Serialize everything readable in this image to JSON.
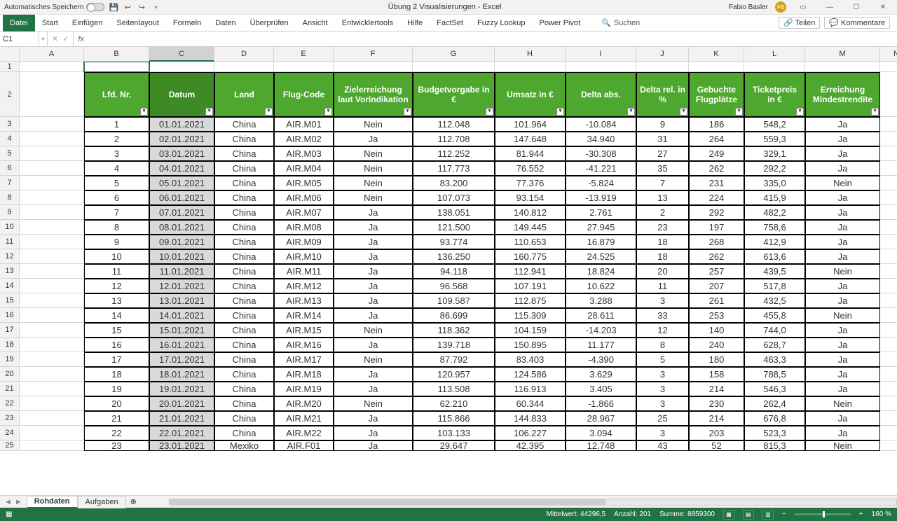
{
  "titlebar": {
    "autosave_label": "Automatisches Speichern",
    "doc_title": "Übung 2 Visualisierungen  -  Excel",
    "user_name": "Fabio Basler",
    "user_initials": "FB"
  },
  "ribbon": {
    "tabs": [
      "Datei",
      "Start",
      "Einfügen",
      "Seitenlayout",
      "Formeln",
      "Daten",
      "Überprüfen",
      "Ansicht",
      "Entwicklertools",
      "Hilfe",
      "FactSet",
      "Fuzzy Lookup",
      "Power Pivot"
    ],
    "search_placeholder": "Suchen",
    "share": "Teilen",
    "comments": "Kommentare"
  },
  "namebox": "C1",
  "columns": [
    "A",
    "B",
    "C",
    "D",
    "E",
    "F",
    "G",
    "H",
    "I",
    "J",
    "K",
    "L",
    "M",
    "N"
  ],
  "headers": [
    "Lfd. Nr.",
    "Datum",
    "Land",
    "Flug-Code",
    "Zielerreichung laut Vorindikation",
    "Budgetvorgabe in €",
    "Umsatz in €",
    "Delta abs.",
    "Delta rel. in %",
    "Gebuchte Flugplätze",
    "Ticketpreis in €",
    "Erreichung Mindestrendite"
  ],
  "rows": [
    [
      1,
      "01.01.2021",
      "China",
      "AIR.M01",
      "Nein",
      "112.048",
      "101.964",
      "-10.084",
      "9",
      "186",
      "548,2",
      "Ja"
    ],
    [
      2,
      "02.01.2021",
      "China",
      "AIR.M02",
      "Ja",
      "112.708",
      "147.648",
      "34.940",
      "31",
      "264",
      "559,3",
      "Ja"
    ],
    [
      3,
      "03.01.2021",
      "China",
      "AIR.M03",
      "Nein",
      "112.252",
      "81.944",
      "-30.308",
      "27",
      "249",
      "329,1",
      "Ja"
    ],
    [
      4,
      "04.01.2021",
      "China",
      "AIR.M04",
      "Nein",
      "117.773",
      "76.552",
      "-41.221",
      "35",
      "262",
      "292,2",
      "Ja"
    ],
    [
      5,
      "05.01.2021",
      "China",
      "AIR.M05",
      "Nein",
      "83.200",
      "77.376",
      "-5.824",
      "7",
      "231",
      "335,0",
      "Nein"
    ],
    [
      6,
      "06.01.2021",
      "China",
      "AIR.M06",
      "Nein",
      "107.073",
      "93.154",
      "-13.919",
      "13",
      "224",
      "415,9",
      "Ja"
    ],
    [
      7,
      "07.01.2021",
      "China",
      "AIR.M07",
      "Ja",
      "138.051",
      "140.812",
      "2.761",
      "2",
      "292",
      "482,2",
      "Ja"
    ],
    [
      8,
      "08.01.2021",
      "China",
      "AIR.M08",
      "Ja",
      "121.500",
      "149.445",
      "27.945",
      "23",
      "197",
      "758,6",
      "Ja"
    ],
    [
      9,
      "09.01.2021",
      "China",
      "AIR.M09",
      "Ja",
      "93.774",
      "110.653",
      "16.879",
      "18",
      "268",
      "412,9",
      "Ja"
    ],
    [
      10,
      "10.01.2021",
      "China",
      "AIR.M10",
      "Ja",
      "136.250",
      "160.775",
      "24.525",
      "18",
      "262",
      "613,6",
      "Ja"
    ],
    [
      11,
      "11.01.2021",
      "China",
      "AIR.M11",
      "Ja",
      "94.118",
      "112.941",
      "18.824",
      "20",
      "257",
      "439,5",
      "Nein"
    ],
    [
      12,
      "12.01.2021",
      "China",
      "AIR.M12",
      "Ja",
      "96.568",
      "107.191",
      "10.622",
      "11",
      "207",
      "517,8",
      "Ja"
    ],
    [
      13,
      "13.01.2021",
      "China",
      "AIR.M13",
      "Ja",
      "109.587",
      "112.875",
      "3.288",
      "3",
      "261",
      "432,5",
      "Ja"
    ],
    [
      14,
      "14.01.2021",
      "China",
      "AIR.M14",
      "Ja",
      "86.699",
      "115.309",
      "28.611",
      "33",
      "253",
      "455,8",
      "Nein"
    ],
    [
      15,
      "15.01.2021",
      "China",
      "AIR.M15",
      "Nein",
      "118.362",
      "104.159",
      "-14.203",
      "12",
      "140",
      "744,0",
      "Ja"
    ],
    [
      16,
      "16.01.2021",
      "China",
      "AIR.M16",
      "Ja",
      "139.718",
      "150.895",
      "11.177",
      "8",
      "240",
      "628,7",
      "Ja"
    ],
    [
      17,
      "17.01.2021",
      "China",
      "AIR.M17",
      "Nein",
      "87.792",
      "83.403",
      "-4.390",
      "5",
      "180",
      "463,3",
      "Ja"
    ],
    [
      18,
      "18.01.2021",
      "China",
      "AIR.M18",
      "Ja",
      "120.957",
      "124.586",
      "3.629",
      "3",
      "158",
      "788,5",
      "Ja"
    ],
    [
      19,
      "19.01.2021",
      "China",
      "AIR.M19",
      "Ja",
      "113.508",
      "116.913",
      "3.405",
      "3",
      "214",
      "546,3",
      "Ja"
    ],
    [
      20,
      "20.01.2021",
      "China",
      "AIR.M20",
      "Nein",
      "62.210",
      "60.344",
      "-1.866",
      "3",
      "230",
      "262,4",
      "Nein"
    ],
    [
      21,
      "21.01.2021",
      "China",
      "AIR.M21",
      "Ja",
      "115.866",
      "144.833",
      "28.967",
      "25",
      "214",
      "676,8",
      "Ja"
    ],
    [
      22,
      "22.01.2021",
      "China",
      "AIR.M22",
      "Ja",
      "103.133",
      "106.227",
      "3.094",
      "3",
      "203",
      "523,3",
      "Ja"
    ],
    [
      23,
      "23.01.2021",
      "Mexiko",
      "AIR.F01",
      "Ja",
      "29.647",
      "42.395",
      "12.748",
      "43",
      "52",
      "815,3",
      "Nein"
    ]
  ],
  "sheets": {
    "active": "Rohdaten",
    "others": [
      "Aufgaben"
    ]
  },
  "statusbar": {
    "avg_label": "Mittelwert:",
    "avg_val": "44296,5",
    "count_label": "Anzahl:",
    "count_val": "201",
    "sum_label": "Summe:",
    "sum_val": "8859300",
    "zoom": "160 %"
  }
}
